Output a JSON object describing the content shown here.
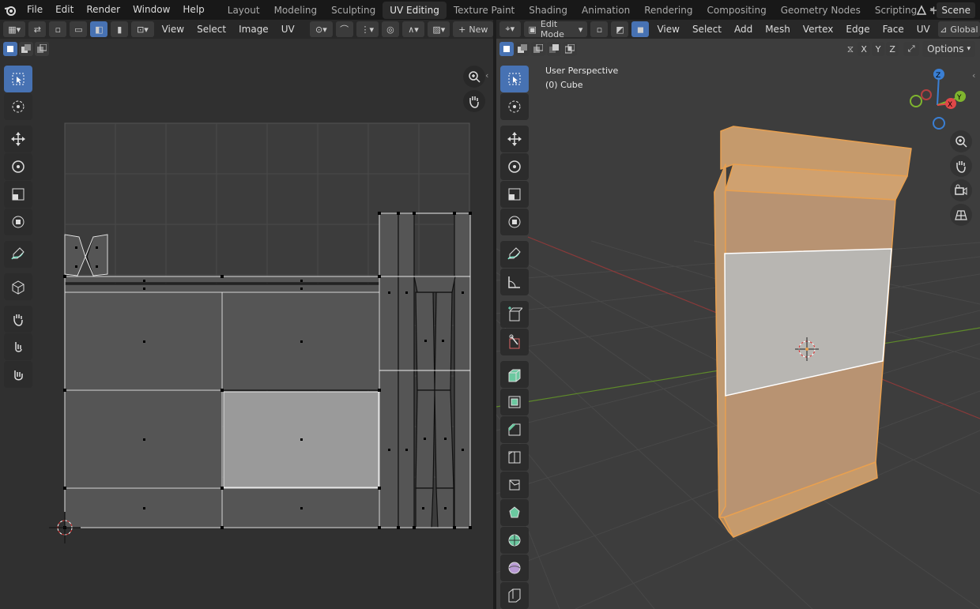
{
  "topbar": {
    "menus": [
      "File",
      "Edit",
      "Render",
      "Window",
      "Help"
    ],
    "workspaces": [
      "Layout",
      "Modeling",
      "Sculpting",
      "UV Editing",
      "Texture Paint",
      "Shading",
      "Animation",
      "Rendering",
      "Compositing",
      "Geometry Nodes",
      "Scripting"
    ],
    "active_workspace": "UV Editing",
    "scene_label": "Scene"
  },
  "uv_editor": {
    "menus": [
      "View",
      "Select",
      "Image",
      "UV"
    ],
    "new_button": "New"
  },
  "viewport": {
    "mode": "Edit Mode",
    "menus": [
      "View",
      "Select",
      "Add",
      "Mesh",
      "Vertex",
      "Edge",
      "Face",
      "UV"
    ],
    "orientation_label": "Global",
    "axes": [
      "X",
      "Y",
      "Z"
    ],
    "options_label": "Options",
    "info_line1": "User Perspective",
    "info_line2": "(0) Cube"
  },
  "colors": {
    "accent": "#4772b3",
    "mesh_orange": "#e8a660",
    "selection_outline": "#f5a623"
  }
}
